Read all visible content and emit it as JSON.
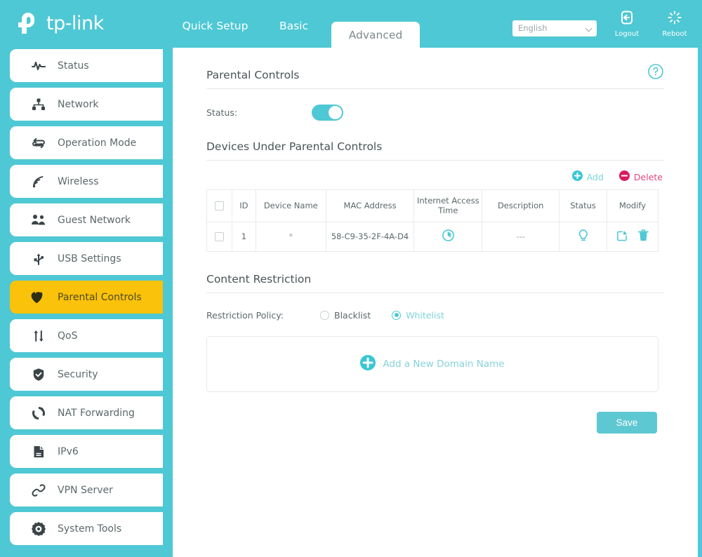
{
  "brand": {
    "name": "tp-link",
    "logo_icon": "tplink-logo-icon"
  },
  "header": {
    "nav": [
      {
        "label": "Quick Setup",
        "active": false
      },
      {
        "label": "Basic",
        "active": false
      },
      {
        "label": "Advanced",
        "active": true
      }
    ],
    "language": {
      "value": "English",
      "icon": "chevron-down-icon"
    },
    "logout": {
      "label": "Logout",
      "icon": "logout-icon"
    },
    "reboot": {
      "label": "Reboot",
      "icon": "reboot-icon"
    }
  },
  "sidebar": {
    "items": [
      {
        "label": "Status",
        "icon": "pulse-icon",
        "active": false
      },
      {
        "label": "Network",
        "icon": "network-tree-icon",
        "active": false
      },
      {
        "label": "Operation Mode",
        "icon": "swap-arrows-icon",
        "active": false
      },
      {
        "label": "Wireless",
        "icon": "wifi-signal-icon",
        "active": false
      },
      {
        "label": "Guest Network",
        "icon": "users-icon",
        "active": false
      },
      {
        "label": "USB Settings",
        "icon": "usb-icon",
        "active": false
      },
      {
        "label": "Parental Controls",
        "icon": "heart-icon",
        "active": true
      },
      {
        "label": "QoS",
        "icon": "up-down-arrows-icon",
        "active": false
      },
      {
        "label": "Security",
        "icon": "shield-check-icon",
        "active": false
      },
      {
        "label": "NAT Forwarding",
        "icon": "refresh-circle-icon",
        "active": false
      },
      {
        "label": "IPv6",
        "icon": "document-icon",
        "active": false
      },
      {
        "label": "VPN Server",
        "icon": "link-chain-icon",
        "active": false
      },
      {
        "label": "System Tools",
        "icon": "gear-icon",
        "active": false
      }
    ]
  },
  "main": {
    "help_icon": "question-circle-icon",
    "parental_controls": {
      "title": "Parental Controls",
      "status_label": "Status:",
      "status_on": true
    },
    "devices": {
      "title": "Devices Under Parental Controls",
      "add_label": "Add",
      "add_icon": "plus-circle-icon",
      "delete_label": "Delete",
      "delete_icon": "minus-circle-icon",
      "columns": [
        "",
        "ID",
        "Device Name",
        "MAC Address",
        "Internet Access Time",
        "Description",
        "Status",
        "Modify"
      ],
      "rows": [
        {
          "id": "1",
          "device_name": "*",
          "mac_address": "58-C9-35-2F-4A-D4",
          "internet_access_time_icon": "clock-icon",
          "description": "---",
          "status_icon": "lightbulb-icon",
          "modify_icons": [
            "edit-icon",
            "trash-icon"
          ]
        }
      ]
    },
    "content_restriction": {
      "title": "Content Restriction",
      "policy_label": "Restriction Policy:",
      "options": [
        {
          "label": "Blacklist",
          "selected": false
        },
        {
          "label": "Whitelist",
          "selected": true
        }
      ],
      "add_domain_label": "Add a New Domain Name",
      "add_domain_icon": "plus-circle-icon"
    },
    "save_label": "Save"
  },
  "colors": {
    "brand_teal": "#4ec8d4",
    "active_amber": "#fac20a",
    "delete_pink": "#e0477f",
    "text_gray": "#5c686b"
  }
}
